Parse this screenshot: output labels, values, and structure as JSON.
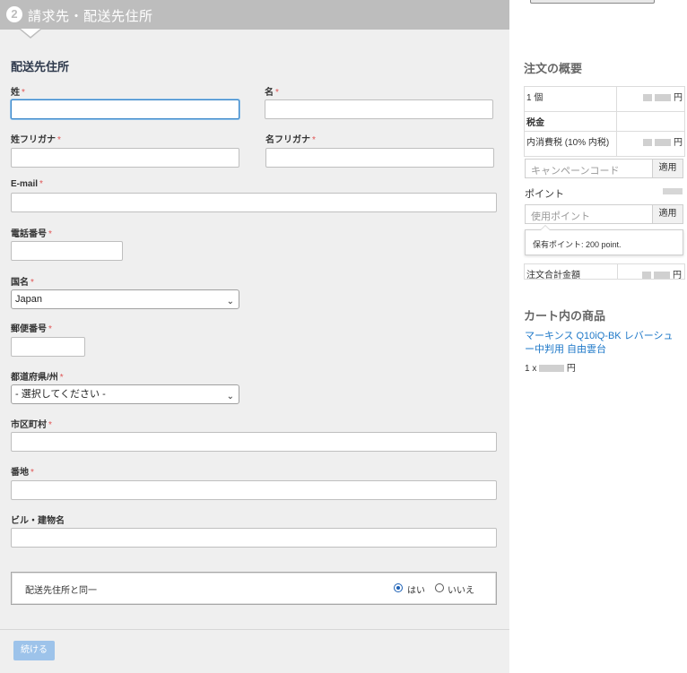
{
  "step": {
    "number": "2",
    "title": "請求先・配送先住所"
  },
  "form": {
    "section_title": "配送先住所",
    "required_mark": "*",
    "last_name_label": "姓",
    "first_name_label": "名",
    "last_kana_label": "姓フリガナ",
    "first_kana_label": "名フリガナ",
    "email_label": "E-mail",
    "phone_label": "電話番号",
    "country_label": "国名",
    "country_value": "Japan",
    "postal_label": "郵便番号",
    "prefecture_label": "都道府県/州",
    "prefecture_value": "- 選択してください -",
    "city_label": "市区町村",
    "address_label": "番地",
    "building_label": "ビル・建物名",
    "same_address_label": "配送先住所と同一",
    "yes_label": "はい",
    "no_label": "いいえ",
    "yes_selected": true,
    "continue_label": "続ける"
  },
  "summary": {
    "title": "注文の概要",
    "qty_label": "1 個",
    "currency": "円",
    "tax_header": "税金",
    "tax_label": "内消費税 (10% 内税)",
    "campaign_placeholder": "キャンペーンコード",
    "apply_label": "適用",
    "points_label": "ポイント",
    "points_placeholder": "使用ポイント",
    "points_held": "保有ポイント: 200 point.",
    "total_label": "注文合計金額"
  },
  "cart": {
    "title": "カート内の商品",
    "item_name": "マーキンス Q10iQ-BK レバーシュー中判用 自由雲台",
    "item_qty_prefix": "1 x",
    "currency": "円"
  },
  "colors": {
    "header_bg": "#bdbdbd",
    "link": "#1e78c8",
    "button": "#9dc3ea",
    "required": "#e05555"
  }
}
